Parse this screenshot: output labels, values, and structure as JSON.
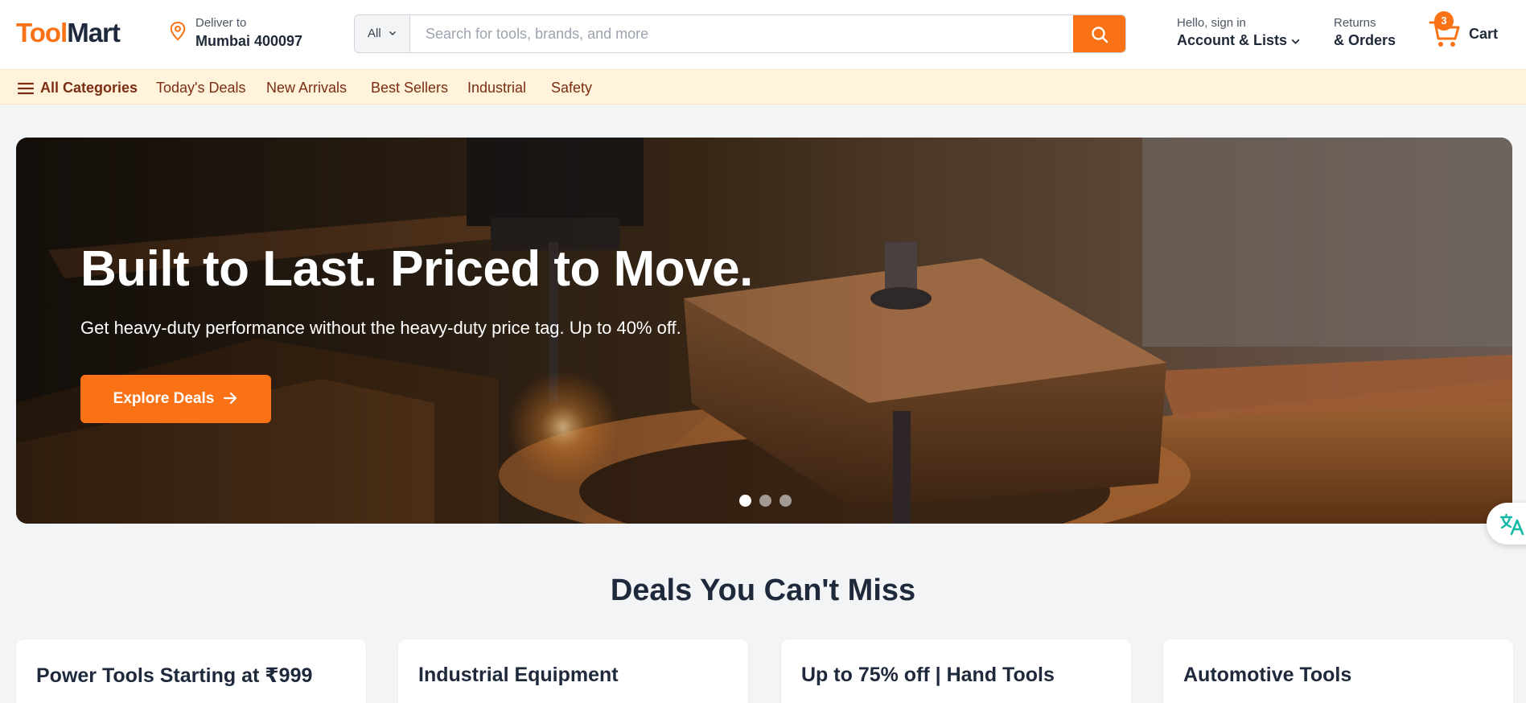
{
  "brand": {
    "name_part1": "Tool",
    "name_part2": "Mart",
    "accent": "#f97316"
  },
  "deliver": {
    "label": "Deliver to",
    "location": "Mumbai 400097",
    "icon": "map-pin-icon"
  },
  "search": {
    "category": "All",
    "placeholder": "Search for tools, brands, and more",
    "value": ""
  },
  "account": {
    "greeting": "Hello, sign in",
    "label": "Account & Lists"
  },
  "returns": {
    "line1": "Returns",
    "line2": "& Orders"
  },
  "cart": {
    "count": "3",
    "label": "Cart"
  },
  "nav": {
    "all_label": "All Categories",
    "items": [
      "Today's Deals",
      "New Arrivals",
      "Best Sellers",
      "Industrial",
      "Safety"
    ]
  },
  "hero": {
    "title": "Built to Last. Priced to Move.",
    "subtitle": "Get heavy-duty performance without the heavy-duty price tag. Up to 40% off.",
    "cta_label": "Explore Deals",
    "slides": 3,
    "active_slide": 1
  },
  "deals": {
    "title": "Deals You Can't Miss",
    "cards": [
      "Power Tools Starting at ₹999",
      "Industrial Equipment",
      "Up to 75% off | Hand Tools",
      "Automotive Tools"
    ]
  }
}
